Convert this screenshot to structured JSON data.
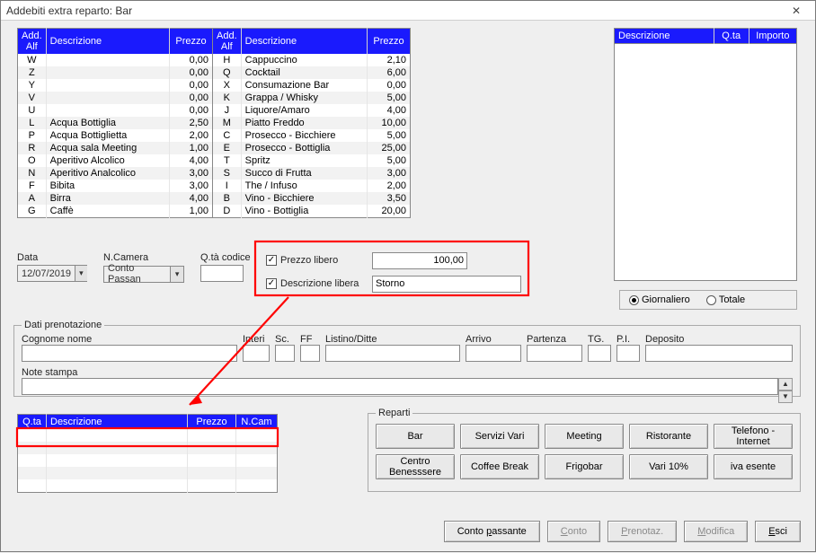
{
  "window": {
    "title": "Addebiti extra reparto: Bar"
  },
  "tables": {
    "items": {
      "headers": {
        "alf": "Add. Alf",
        "desc": "Descrizione",
        "price": "Prezzo"
      },
      "left": [
        {
          "alf": "W",
          "desc": "",
          "price": "0,00"
        },
        {
          "alf": "Z",
          "desc": "",
          "price": "0,00"
        },
        {
          "alf": "Y",
          "desc": "",
          "price": "0,00"
        },
        {
          "alf": "V",
          "desc": "",
          "price": "0,00"
        },
        {
          "alf": "U",
          "desc": "",
          "price": "0,00"
        },
        {
          "alf": "L",
          "desc": "Acqua Bottiglia",
          "price": "2,50"
        },
        {
          "alf": "P",
          "desc": "Acqua Bottiglietta",
          "price": "2,00"
        },
        {
          "alf": "R",
          "desc": "Acqua sala Meeting",
          "price": "1,00"
        },
        {
          "alf": "O",
          "desc": "Aperitivo Alcolico",
          "price": "4,00"
        },
        {
          "alf": "N",
          "desc": "Aperitivo Analcolico",
          "price": "3,00"
        },
        {
          "alf": "F",
          "desc": "Bibita",
          "price": "3,00"
        },
        {
          "alf": "A",
          "desc": "Birra",
          "price": "4,00"
        },
        {
          "alf": "G",
          "desc": "Caffè",
          "price": "1,00"
        }
      ],
      "right": [
        {
          "alf": "H",
          "desc": "Cappuccino",
          "price": "2,10"
        },
        {
          "alf": "Q",
          "desc": "Cocktail",
          "price": "6,00"
        },
        {
          "alf": "X",
          "desc": "Consumazione Bar",
          "price": "0,00"
        },
        {
          "alf": "K",
          "desc": "Grappa / Whisky",
          "price": "5,00"
        },
        {
          "alf": "J",
          "desc": "Liquore/Amaro",
          "price": "4,00"
        },
        {
          "alf": "M",
          "desc": "Piatto Freddo",
          "price": "10,00"
        },
        {
          "alf": "C",
          "desc": "Prosecco - Bicchiere",
          "price": "5,00"
        },
        {
          "alf": "E",
          "desc": "Prosecco - Bottiglia",
          "price": "25,00"
        },
        {
          "alf": "T",
          "desc": "Spritz",
          "price": "5,00"
        },
        {
          "alf": "S",
          "desc": "Succo di Frutta",
          "price": "3,00"
        },
        {
          "alf": "I",
          "desc": "The / Infuso",
          "price": "2,00"
        },
        {
          "alf": "B",
          "desc": "Vino - Bicchiere",
          "price": "3,50"
        },
        {
          "alf": "D",
          "desc": "Vino - Bottiglia",
          "price": "20,00"
        }
      ]
    },
    "summary": {
      "headers": {
        "desc": "Descrizione",
        "qty": "Q.ta",
        "amount": "Importo"
      }
    },
    "charges": {
      "headers": {
        "qty": "Q.ta",
        "desc": "Descrizione",
        "price": "Prezzo",
        "ncam": "N.Cam"
      }
    }
  },
  "controls": {
    "date": {
      "label": "Data",
      "value": "12/07/2019"
    },
    "room": {
      "label": "N.Camera",
      "value": "Conto Passan"
    },
    "qtycode": {
      "label": "Q.tà codice",
      "value": ""
    }
  },
  "free": {
    "price_label": "Prezzo libero",
    "price_value": "100,00",
    "desc_label": "Descrizione libera",
    "desc_value": "Storno"
  },
  "radios": {
    "daily": "Giornaliero",
    "total": "Totale"
  },
  "booking": {
    "legend": "Dati prenotazione",
    "cognome_label": "Cognome nome",
    "interi_label": "Interi",
    "sc_label": "Sc.",
    "ff_label": "FF",
    "listino_label": "Listino/Ditte",
    "arrivo_label": "Arrivo",
    "partenza_label": "Partenza",
    "tg_label": "TG.",
    "pi_label": "P.I.",
    "deposito_label": "Deposito",
    "note_label": "Note stampa"
  },
  "departments": {
    "legend": "Reparti",
    "buttons": [
      "Bar",
      "Servizi Vari",
      "Meeting",
      "Ristorante",
      "Telefono - Internet",
      "Centro Benesssere",
      "Coffee Break",
      "Frigobar",
      "Vari 10%",
      "iva esente"
    ]
  },
  "footer": [
    {
      "pre": "Conto ",
      "u": "p",
      "post": "assante"
    },
    {
      "u": "C",
      "post": "onto"
    },
    {
      "u": "P",
      "post": "renotaz."
    },
    {
      "u": "M",
      "post": "odifica"
    },
    {
      "u": "E",
      "post": "sci"
    }
  ]
}
